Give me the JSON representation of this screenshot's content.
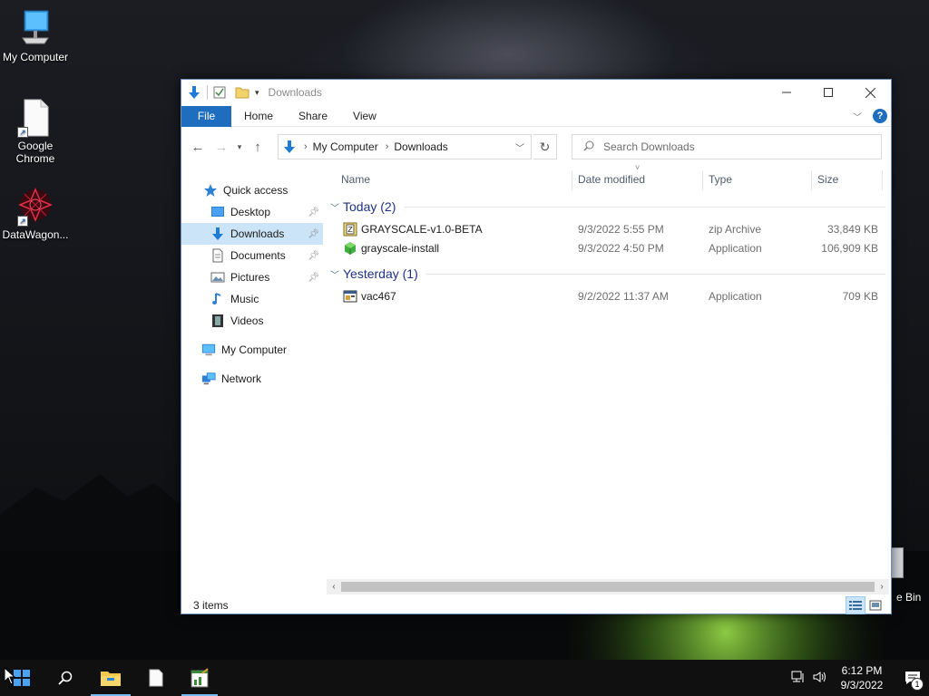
{
  "desktop": {
    "icons": [
      {
        "label": "My Computer",
        "icon": "monitor-icon"
      },
      {
        "label": "Google Chrome",
        "icon": "blank-file-icon"
      },
      {
        "label": "DataWagon...",
        "icon": "datawagon-icon"
      }
    ],
    "recycle_bin_label": "e Bin"
  },
  "window": {
    "title": "Downloads",
    "ribbon": {
      "tabs": [
        "File",
        "Home",
        "Share",
        "View"
      ]
    },
    "address": {
      "crumbs": [
        "My Computer",
        "Downloads"
      ]
    },
    "search": {
      "placeholder": "Search Downloads"
    },
    "nav_pane": [
      {
        "label": "Quick access",
        "icon": "star-icon",
        "pinned": false,
        "selected": false
      },
      {
        "label": "Desktop",
        "icon": "desktop-icon",
        "pinned": true,
        "selected": false
      },
      {
        "label": "Downloads",
        "icon": "download-arrow-icon",
        "pinned": true,
        "selected": true
      },
      {
        "label": "Documents",
        "icon": "document-icon",
        "pinned": true,
        "selected": false
      },
      {
        "label": "Pictures",
        "icon": "pictures-icon",
        "pinned": true,
        "selected": false
      },
      {
        "label": "Music",
        "icon": "music-note-icon",
        "pinned": false,
        "selected": false
      },
      {
        "label": "Videos",
        "icon": "film-icon",
        "pinned": false,
        "selected": false
      },
      {
        "label": "My Computer",
        "icon": "computer-icon",
        "pinned": false,
        "selected": false
      },
      {
        "label": "Network",
        "icon": "network-icon",
        "pinned": false,
        "selected": false
      }
    ],
    "columns": [
      "Name",
      "Date modified",
      "Type",
      "Size"
    ],
    "groups": [
      {
        "label": "Today (2)",
        "files": [
          {
            "name": "GRAYSCALE-v1.0-BETA",
            "date": "9/3/2022 5:55 PM",
            "type": "zip Archive",
            "size": "33,849 KB",
            "icon": "zip-archive-icon"
          },
          {
            "name": "grayscale-install",
            "date": "9/3/2022 4:50 PM",
            "type": "Application",
            "size": "106,909 KB",
            "icon": "green-cube-icon"
          }
        ]
      },
      {
        "label": "Yesterday (1)",
        "files": [
          {
            "name": "vac467",
            "date": "9/2/2022 11:37 AM",
            "type": "Application",
            "size": "709 KB",
            "icon": "app-window-icon"
          }
        ]
      }
    ],
    "status": {
      "item_count": "3 items"
    }
  },
  "taskbar": {
    "time": "6:12 PM",
    "date": "9/3/2022",
    "notification_count": "1"
  },
  "colors": {
    "accent": "#1f6dbf",
    "selection": "#cce4f7",
    "group_header": "#1e3287"
  }
}
